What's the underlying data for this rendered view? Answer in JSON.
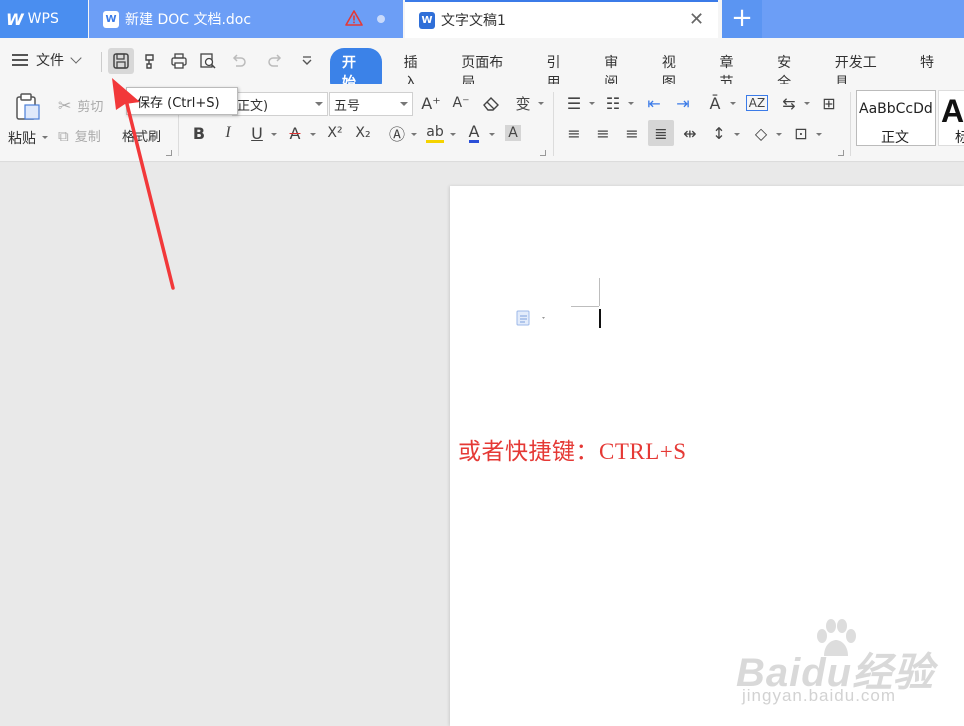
{
  "titlebar": {
    "app_tab": "WPS",
    "tabs": [
      {
        "label": "新建 DOC 文档.doc",
        "state": "inactive",
        "has_warning": true
      },
      {
        "label": "文字文稿1",
        "state": "active"
      }
    ],
    "new_tab_symbol": "+"
  },
  "menubar": {
    "file_label": "文件",
    "tabs": [
      "开始",
      "插入",
      "页面布局",
      "引用",
      "审阅",
      "视图",
      "章节",
      "安全",
      "开发工具",
      "特"
    ],
    "active_tab": "开始"
  },
  "tooltip": {
    "text": "保存 (Ctrl+S)"
  },
  "ribbon": {
    "paste_label": "粘贴",
    "cut_label": "剪切",
    "copy_label": "复制",
    "format_painter_label": "格式刷",
    "font_name": "正文)",
    "font_size": "五号",
    "styles": [
      {
        "sample": "AaBbCcDd",
        "name": "正文"
      },
      {
        "sample": "Aa",
        "name": "标"
      }
    ]
  },
  "document": {
    "body_text": "或者快捷键：CTRL+S"
  },
  "watermark": {
    "main": "Baidu经验",
    "sub": "jingyan.baidu.com"
  },
  "colors": {
    "accent": "#3b82e8",
    "tab_blue": "#6c9ef6",
    "doc_text": "#e53935",
    "arrow": "#f2383a"
  }
}
